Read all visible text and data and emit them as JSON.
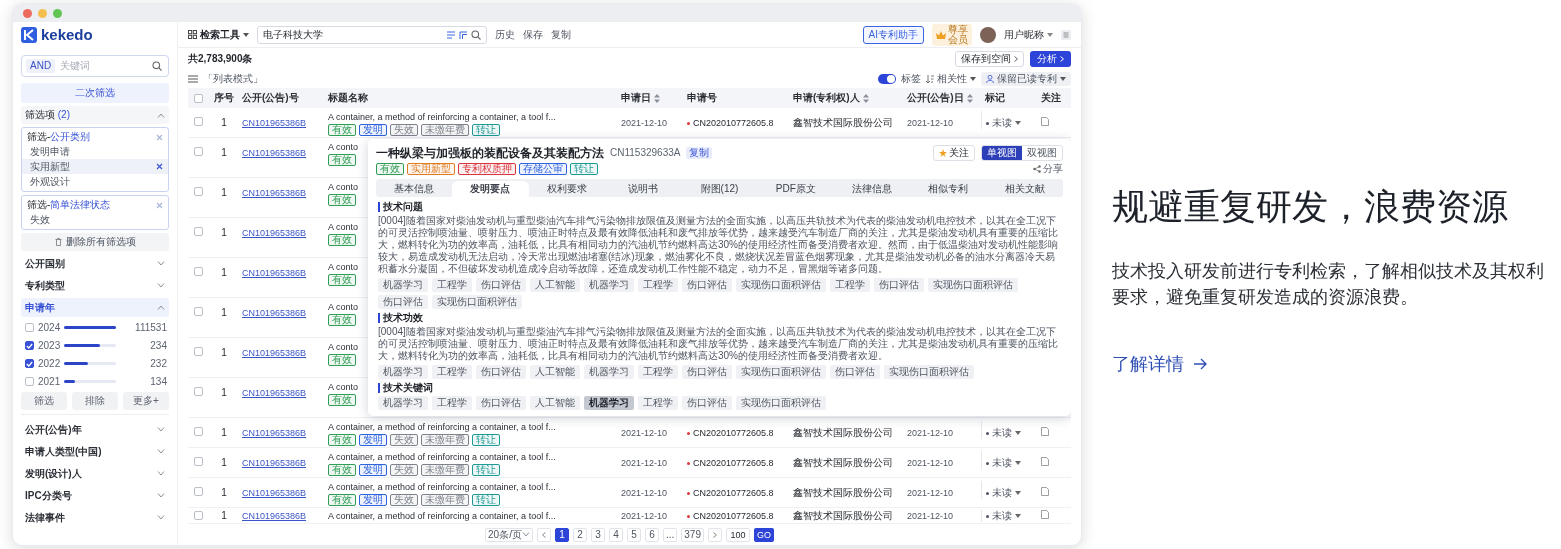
{
  "app": {
    "logo": "kekedo",
    "sidebar": {
      "search": {
        "operator": "AND",
        "placeholder": "关键词"
      },
      "refine_button": "二次筛选",
      "filters_title": "筛选项",
      "filters_count": "(2)",
      "filters_expanded": true,
      "filter_groups": [
        {
          "prefix": "筛选-",
          "name": "公开类别",
          "items": [
            {
              "label": "发明申请",
              "selected": false
            },
            {
              "label": "实用新型",
              "selected": true
            },
            {
              "label": "外观设计",
              "selected": false
            }
          ]
        },
        {
          "prefix": "筛选-",
          "name": "简单法律状态",
          "items": [
            {
              "label": "失效",
              "selected": false
            }
          ]
        }
      ],
      "clear_button": "删除所有筛选项",
      "facets": [
        {
          "label": "公开国别",
          "expanded": false
        },
        {
          "label": "专利类型",
          "expanded": false
        },
        {
          "label": "申请年",
          "expanded": true,
          "values": [
            {
              "label": "2024",
              "checked": false,
              "level": 1,
              "count": "111531"
            },
            {
              "label": "2023",
              "checked": true,
              "level": 0.68,
              "count": "234"
            },
            {
              "label": "2022",
              "checked": true,
              "level": 0.46,
              "count": "232"
            },
            {
              "label": "2021",
              "checked": false,
              "level": 0.2,
              "count": "134"
            }
          ],
          "buttons": [
            "筛选",
            "排除",
            "更多+"
          ]
        },
        {
          "label": "公开(公告)年",
          "expanded": false
        },
        {
          "label": "申请人类型(中国)",
          "expanded": false
        },
        {
          "label": "发明(设计)人",
          "expanded": false
        },
        {
          "label": "IPC分类号",
          "expanded": false
        },
        {
          "label": "法律事件",
          "expanded": false
        }
      ]
    },
    "header": {
      "tool_menu": "检索工具",
      "search_value": "电子科技大学",
      "links": [
        "历史",
        "保存",
        "复制"
      ],
      "ai_button": "AI专利助手",
      "vip_badge": "尊享会员",
      "user_name": "用户昵称"
    },
    "toolbar": {
      "result_count": "共2,783,900条",
      "save_button": "保存到空间",
      "analyze_button": "分析",
      "view_mode": "「列表模式」",
      "tag_toggle": {
        "label": "标签",
        "on": true
      },
      "sort": "相关性",
      "read_filter": "保留已读专利"
    },
    "table": {
      "header_checked": false,
      "columns": [
        {
          "label": "序号",
          "sortable": false
        },
        {
          "label": "公开(公告)号",
          "sortable": false
        },
        {
          "label": "标题名称",
          "sortable": false
        },
        {
          "label": "申请日",
          "sortable": true
        },
        {
          "label": "申请号",
          "sortable": false
        },
        {
          "label": "申请(专利权)人",
          "sortable": true
        },
        {
          "label": "公开(公告)日",
          "sortable": true
        },
        {
          "label": "标记",
          "sortable": false
        },
        {
          "label": "关注",
          "sortable": false
        }
      ],
      "rows": [
        {
          "kind": "full",
          "checked": false,
          "seq": "1",
          "number": "CN101965386B",
          "title": "A container, a method of reinforcing a container, a tool f...",
          "tags": [
            {
              "label": "有效",
              "color": "#2f9e55"
            },
            {
              "label": "发明",
              "color": "#2f63e0"
            },
            {
              "label": "失效",
              "color": "#7d838c"
            },
            {
              "label": "未缴年费",
              "color": "#7d838c"
            },
            {
              "label": "转让",
              "color": "#1d9a94"
            }
          ],
          "filing_date": "2021-12-10",
          "application_no": "CN202010772605.8",
          "applicant": "鑫智技术国际股份公司",
          "publication_date": "2021-12-10",
          "mark": "未读"
        },
        {
          "kind": "covered",
          "checked": false,
          "seq": "1",
          "number": "CN101965386B",
          "title": "A conto",
          "tags": [
            {
              "label": "有效",
              "color": "#2f9e55"
            }
          ]
        },
        {
          "kind": "covered",
          "checked": false,
          "seq": "1",
          "number": "CN101965386B",
          "title": "A conto",
          "tags": [
            {
              "label": "有效",
              "color": "#2f9e55"
            }
          ]
        },
        {
          "kind": "covered",
          "checked": false,
          "seq": "1",
          "number": "CN101965386B",
          "title": "A conto",
          "tags": [
            {
              "label": "有效",
              "color": "#2f9e55"
            }
          ]
        },
        {
          "kind": "covered",
          "checked": false,
          "seq": "1",
          "number": "CN101965386B",
          "title": "A conto",
          "tags": [
            {
              "label": "有效",
              "color": "#2f9e55"
            }
          ]
        },
        {
          "kind": "covered",
          "checked": false,
          "seq": "1",
          "number": "CN101965386B",
          "title": "A conto",
          "tags": [
            {
              "label": "有效",
              "color": "#2f9e55"
            }
          ]
        },
        {
          "kind": "covered",
          "checked": false,
          "seq": "1",
          "number": "CN101965386B",
          "title": "A conto",
          "tags": [
            {
              "label": "有效",
              "color": "#2f9e55"
            }
          ]
        },
        {
          "kind": "covered",
          "checked": false,
          "seq": "1",
          "number": "CN101965386B",
          "title": "A conto",
          "tags": [
            {
              "label": "有效",
              "color": "#2f9e55"
            }
          ]
        },
        {
          "kind": "full",
          "checked": false,
          "seq": "1",
          "number": "CN101965386B",
          "title": "A container, a method of reinforcing a container, a tool f...",
          "tags": [
            {
              "label": "有效",
              "color": "#2f9e55"
            },
            {
              "label": "发明",
              "color": "#2f63e0"
            },
            {
              "label": "失效",
              "color": "#7d838c"
            },
            {
              "label": "未缴年费",
              "color": "#7d838c"
            },
            {
              "label": "转让",
              "color": "#1d9a94"
            }
          ],
          "filing_date": "2021-12-10",
          "application_no": "CN202010772605.8",
          "applicant": "鑫智技术国际股份公司",
          "publication_date": "2021-12-10",
          "mark": "未读"
        },
        {
          "kind": "full",
          "checked": false,
          "seq": "1",
          "number": "CN101965386B",
          "title": "A container, a method of reinforcing a container, a tool f...",
          "tags": [
            {
              "label": "有效",
              "color": "#2f9e55"
            },
            {
              "label": "发明",
              "color": "#2f63e0"
            },
            {
              "label": "失效",
              "color": "#7d838c"
            },
            {
              "label": "未缴年费",
              "color": "#7d838c"
            },
            {
              "label": "转让",
              "color": "#1d9a94"
            }
          ],
          "filing_date": "2021-12-10",
          "application_no": "CN202010772605.8",
          "applicant": "鑫智技术国际股份公司",
          "publication_date": "2021-12-10",
          "mark": "未读"
        },
        {
          "kind": "full",
          "checked": false,
          "seq": "1",
          "number": "CN101965386B",
          "title": "A container, a method of reinforcing a container, a tool f...",
          "tags": [
            {
              "label": "有效",
              "color": "#2f9e55"
            },
            {
              "label": "发明",
              "color": "#2f63e0"
            },
            {
              "label": "失效",
              "color": "#7d838c"
            },
            {
              "label": "未缴年费",
              "color": "#7d838c"
            },
            {
              "label": "转让",
              "color": "#1d9a94"
            }
          ],
          "filing_date": "2021-12-10",
          "application_no": "CN202010772605.8",
          "applicant": "鑫智技术国际股份公司",
          "publication_date": "2021-12-10",
          "mark": "未读"
        },
        {
          "kind": "partial",
          "checked": false,
          "seq": "1",
          "number": "CN101965386B",
          "title": "A container, a method of reinforcing a container, a tool f...",
          "filing_date": "2021-12-10",
          "application_no": "CN202010772605.8",
          "applicant": "鑫智技术国际股份公司",
          "publication_date": "2021-12-10",
          "mark": "未读"
        }
      ]
    },
    "detail_popup": {
      "title": "一种纵梁与加强板的装配设备及其装配方法",
      "number": "CN115329633A",
      "number_badge": "复制",
      "tags": [
        {
          "label": "有效",
          "color": "#2f9e55"
        },
        {
          "label": "实用新型",
          "color": "#e07b22"
        },
        {
          "label": "专利权质押",
          "color": "#d9363e"
        },
        {
          "label": "存储公审",
          "color": "#2f63e0"
        },
        {
          "label": "转让",
          "color": "#1d9a94"
        }
      ],
      "follow_button": "关注",
      "views": [
        {
          "label": "单视图",
          "selected": true
        },
        {
          "label": "双视图",
          "selected": false
        }
      ],
      "share_button": "分享",
      "tabs": [
        {
          "label": "基本信息",
          "selected": false
        },
        {
          "label": "发明要点",
          "selected": true
        },
        {
          "label": "权利要求",
          "selected": false
        },
        {
          "label": "说明书",
          "selected": false
        },
        {
          "label": "附图(12)",
          "selected": false
        },
        {
          "label": "PDF原文",
          "selected": false
        },
        {
          "label": "法律信息",
          "selected": false
        },
        {
          "label": "相似专利",
          "selected": false
        },
        {
          "label": "相关文献",
          "selected": false
        }
      ],
      "sections": [
        {
          "heading": "技术问题",
          "text": "[0004]随着国家对柴油发动机与重型柴油汽车排气污染物排放限值及测量方法的全面实施，以高压共轨技术为代表的柴油发动机电控技术，以其在全工况下的可灵活控制喷油量、喷射压力、喷油正时特点及最有效降低油耗和废气排放等优势，越来越受汽车制造厂商的关注，尤其是柴油发动机具有重要的压缩比大，燃料转化为功的效率高，油耗低，比具有相同动力的汽油机节约燃料高达30%的使用经济性而备受消费者欢迎。然而，由于低温柴油对发动机性能影响较大，易造成发动机无法启动，冷天常出现燃油堵塞(结冰)现象，燃油雾化不良，燃烧状况差冒蓝色烟雾现象，尤其是柴油发动机必备的油水分离器冷天易积蓄水分凝固，不但破坏发动机造成冷启动等故障，还造成发动机工作性能不稳定，动力不足，冒黑烟等诸多问题。",
          "chips": [
            {
              "label": "机器学习",
              "selected": false
            },
            {
              "label": "工程学",
              "selected": false
            },
            {
              "label": "伤口评估",
              "selected": false
            },
            {
              "label": "人工智能",
              "selected": false
            },
            {
              "label": "机器学习",
              "selected": false
            },
            {
              "label": "工程学",
              "selected": false
            },
            {
              "label": "伤口评估",
              "selected": false
            },
            {
              "label": "实现伤口面积评估",
              "selected": false
            },
            {
              "label": "工程学",
              "selected": false
            },
            {
              "label": "伤口评估",
              "selected": false
            },
            {
              "label": "实现伤口面积评估",
              "selected": false
            },
            {
              "label": "伤口评估",
              "selected": false
            },
            {
              "label": "实现伤口面积评估",
              "selected": false
            }
          ]
        },
        {
          "heading": "技术功效",
          "text": "[0004]随着国家对柴油发动机与重型柴油汽车排气污染物排放限值及测量方法的全面实施，以高压共轨技术为代表的柴油发动机电控技术，以其在全工况下的可灵活控制喷油量、喷射压力、喷油正时特点及最有效降低油耗和废气排放等优势，越来越受汽车制造厂商的关注，尤其是柴油发动机具有重要的压缩比大，燃料转化为功的效率高，油耗低，比具有相同动力的汽油机节约燃料高达30%的使用经济性而备受消费者欢迎。",
          "chips": [
            {
              "label": "机器学习",
              "selected": false
            },
            {
              "label": "工程学",
              "selected": false
            },
            {
              "label": "伤口评估",
              "selected": false
            },
            {
              "label": "人工智能",
              "selected": false
            },
            {
              "label": "机器学习",
              "selected": false
            },
            {
              "label": "工程学",
              "selected": false
            },
            {
              "label": "伤口评估",
              "selected": false
            },
            {
              "label": "实现伤口面积评估",
              "selected": false
            },
            {
              "label": "伤口评估",
              "selected": false
            },
            {
              "label": "实现伤口面积评估",
              "selected": false
            }
          ]
        },
        {
          "heading": "技术关键词",
          "chips": [
            {
              "label": "机器学习",
              "selected": false
            },
            {
              "label": "工程学",
              "selected": false
            },
            {
              "label": "伤口评估",
              "selected": false
            },
            {
              "label": "人工智能",
              "selected": false
            },
            {
              "label": "机器学习",
              "selected": true
            },
            {
              "label": "工程学",
              "selected": false
            },
            {
              "label": "伤口评估",
              "selected": false
            },
            {
              "label": "实现伤口面积评估",
              "selected": false
            }
          ]
        }
      ]
    },
    "pagination": {
      "page_size": "20条/页",
      "pages": [
        {
          "label": "1",
          "selected": true
        },
        {
          "label": "2",
          "selected": false
        },
        {
          "label": "3",
          "selected": false
        },
        {
          "label": "4",
          "selected": false
        },
        {
          "label": "5",
          "selected": false
        },
        {
          "label": "6",
          "selected": false
        },
        {
          "label": "...",
          "selected": false
        },
        {
          "label": "379",
          "selected": false
        }
      ],
      "jump_value": "100",
      "go_button": "GO"
    }
  },
  "promo": {
    "heading": "规避重复研发，浪费资源",
    "description": "技术投入研发前进行专利检索，了解相似技术及其权利要求，避免重复研发造成的资源浪费。",
    "link": "了解详情"
  }
}
